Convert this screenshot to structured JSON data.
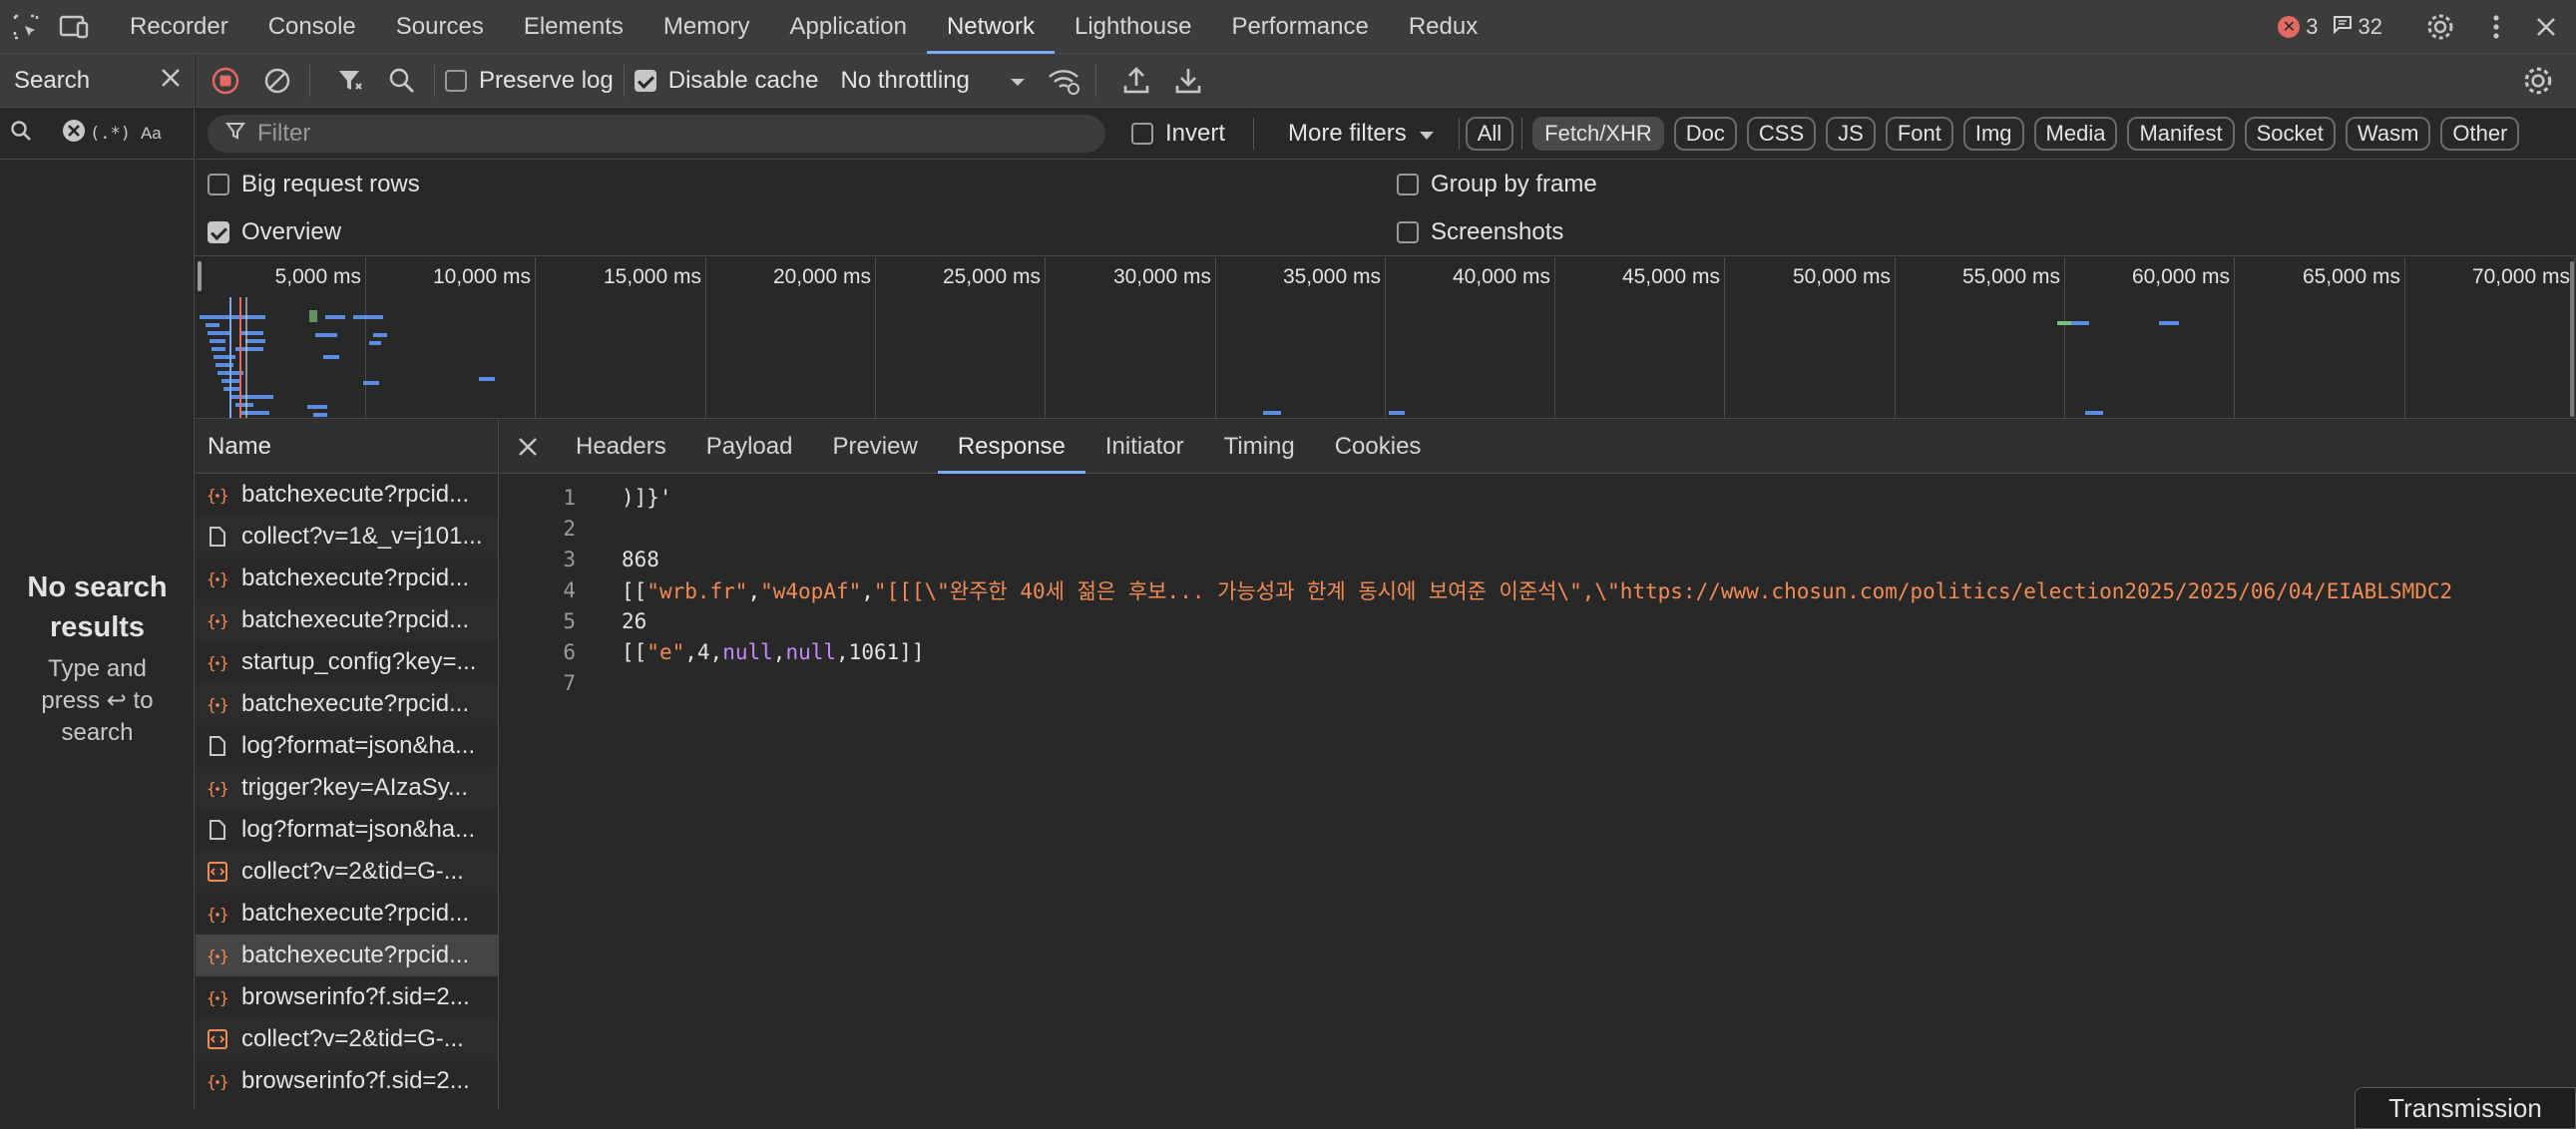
{
  "topbar": {
    "tabs": [
      "Recorder",
      "Console",
      "Sources",
      "Elements",
      "Memory",
      "Application",
      "Network",
      "Lighthouse",
      "Performance",
      "Redux"
    ],
    "active_tab": "Network",
    "error_count": "3",
    "message_count": "32"
  },
  "search_panel": {
    "title": "Search",
    "regex_label": "(.*)",
    "case_label": "Aa",
    "no_results_title": "No search results",
    "no_results_hint": "Type and press ↩ to search"
  },
  "toolbar": {
    "preserve_log": "Preserve log",
    "disable_cache": "Disable cache",
    "throttling": "No throttling"
  },
  "filter": {
    "placeholder": "Filter",
    "invert": "Invert",
    "more_filters": "More filters",
    "types": [
      "All",
      "Fetch/XHR",
      "Doc",
      "CSS",
      "JS",
      "Font",
      "Img",
      "Media",
      "Manifest",
      "Socket",
      "Wasm",
      "Other"
    ],
    "selected_type": "Fetch/XHR"
  },
  "settings": {
    "big_request_rows": "Big request rows",
    "overview": "Overview",
    "group_by_frame": "Group by frame",
    "screenshots": "Screenshots"
  },
  "overview": {
    "ticks": [
      "5,000 ms",
      "10,000 ms",
      "15,000 ms",
      "20,000 ms",
      "25,000 ms",
      "30,000 ms",
      "35,000 ms",
      "40,000 ms",
      "45,000 ms",
      "50,000 ms",
      "55,000 ms",
      "60,000 ms",
      "65,000 ms",
      "70,000 ms"
    ]
  },
  "requests": {
    "header": "Name",
    "rows": [
      {
        "name": "batchexecute?rpcid...",
        "icon": "xhr-icon"
      },
      {
        "name": "collect?v=1&_v=j101...",
        "icon": "document-icon"
      },
      {
        "name": "batchexecute?rpcid...",
        "icon": "xhr-icon"
      },
      {
        "name": "batchexecute?rpcid...",
        "icon": "xhr-icon"
      },
      {
        "name": "startup_config?key=...",
        "icon": "xhr-icon"
      },
      {
        "name": "batchexecute?rpcid...",
        "icon": "xhr-icon"
      },
      {
        "name": "log?format=json&ha...",
        "icon": "document-icon"
      },
      {
        "name": "trigger?key=AIzaSy...",
        "icon": "xhr-icon"
      },
      {
        "name": "log?format=json&ha...",
        "icon": "document-icon"
      },
      {
        "name": "collect?v=2&tid=G-...",
        "icon": "script-icon"
      },
      {
        "name": "batchexecute?rpcid...",
        "icon": "xhr-icon"
      },
      {
        "name": "batchexecute?rpcid...",
        "icon": "xhr-icon",
        "selected": true
      },
      {
        "name": "browserinfo?f.sid=2...",
        "icon": "xhr-icon"
      },
      {
        "name": "collect?v=2&tid=G-...",
        "icon": "script-icon"
      },
      {
        "name": "browserinfo?f.sid=2...",
        "icon": "xhr-icon"
      }
    ]
  },
  "detail": {
    "tabs": [
      "Headers",
      "Payload",
      "Preview",
      "Response",
      "Initiator",
      "Timing",
      "Cookies"
    ],
    "active_tab": "Response",
    "line_numbers": [
      "1",
      "2",
      "3",
      "4",
      "5",
      "6",
      "7"
    ],
    "line1": ")]}'",
    "line3": "868",
    "line4_a": "\"wrb.fr\"",
    "line4_b": "\"w4opAf\"",
    "line4_c": "\"[[[\\\"완주한 40세 젊은 후보... 가능성과 한계 동시에 보여준 이준석\\\",\\\"https://www.chosun.com/politics/election2025/2025/06/04/EIABLSMDC2",
    "line5": "26",
    "line6_e": "\"e\"",
    "line6_num1": "4",
    "line6_null": "null",
    "line6_num2": "1061",
    "transmission": "Transmission"
  }
}
